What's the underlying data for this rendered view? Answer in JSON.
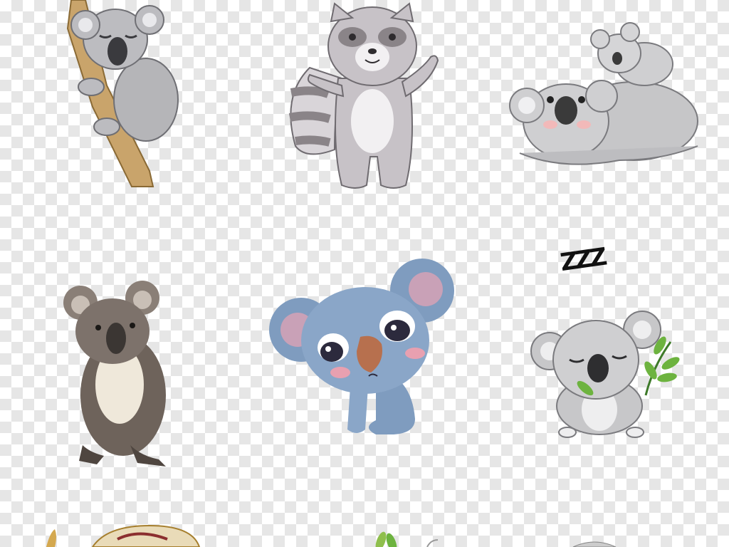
{
  "canvas": {
    "background": "transparent-checkerboard",
    "checker_colors": [
      "#ffffff",
      "#e6e6e6"
    ]
  },
  "illustrations": [
    {
      "name": "koala-climbing-tree",
      "style": "cartoon",
      "colors": {
        "fur": "#b5b5b8",
        "branch": "#c9a46b"
      }
    },
    {
      "name": "raccoon-waving",
      "style": "cartoon",
      "colors": {
        "fur": "#c7c2c7",
        "stripes": "#8a8488"
      }
    },
    {
      "name": "koala-mother-with-baby",
      "style": "cartoon",
      "colors": {
        "fur": "#c6c6c8",
        "nose": "#3a3a3a"
      }
    },
    {
      "name": "koala-photo",
      "style": "photo",
      "colors": {
        "fur": "#6e635b",
        "chest": "#efe8da"
      }
    },
    {
      "name": "koala-blue-sad",
      "style": "flat",
      "colors": {
        "fur": "#7f9cbf",
        "ears": "#c9a1b7",
        "nose": "#b7704e"
      }
    },
    {
      "name": "koala-sleeping-eucalyptus",
      "style": "cartoon",
      "colors": {
        "fur": "#c7c7c9",
        "leaves": "#6db33f"
      }
    },
    {
      "name": "koala-partial-bottom-left",
      "style": "cartoon",
      "colors": {
        "accent": "#d4a84f"
      }
    },
    {
      "name": "koala-partial-bottom-center",
      "style": "cartoon",
      "colors": {
        "leaves": "#8fbf4d"
      }
    },
    {
      "name": "koala-partial-bottom-right",
      "style": "cartoon",
      "colors": {
        "fur": "#cccccc"
      }
    }
  ],
  "sleep_text": "ZZZ"
}
